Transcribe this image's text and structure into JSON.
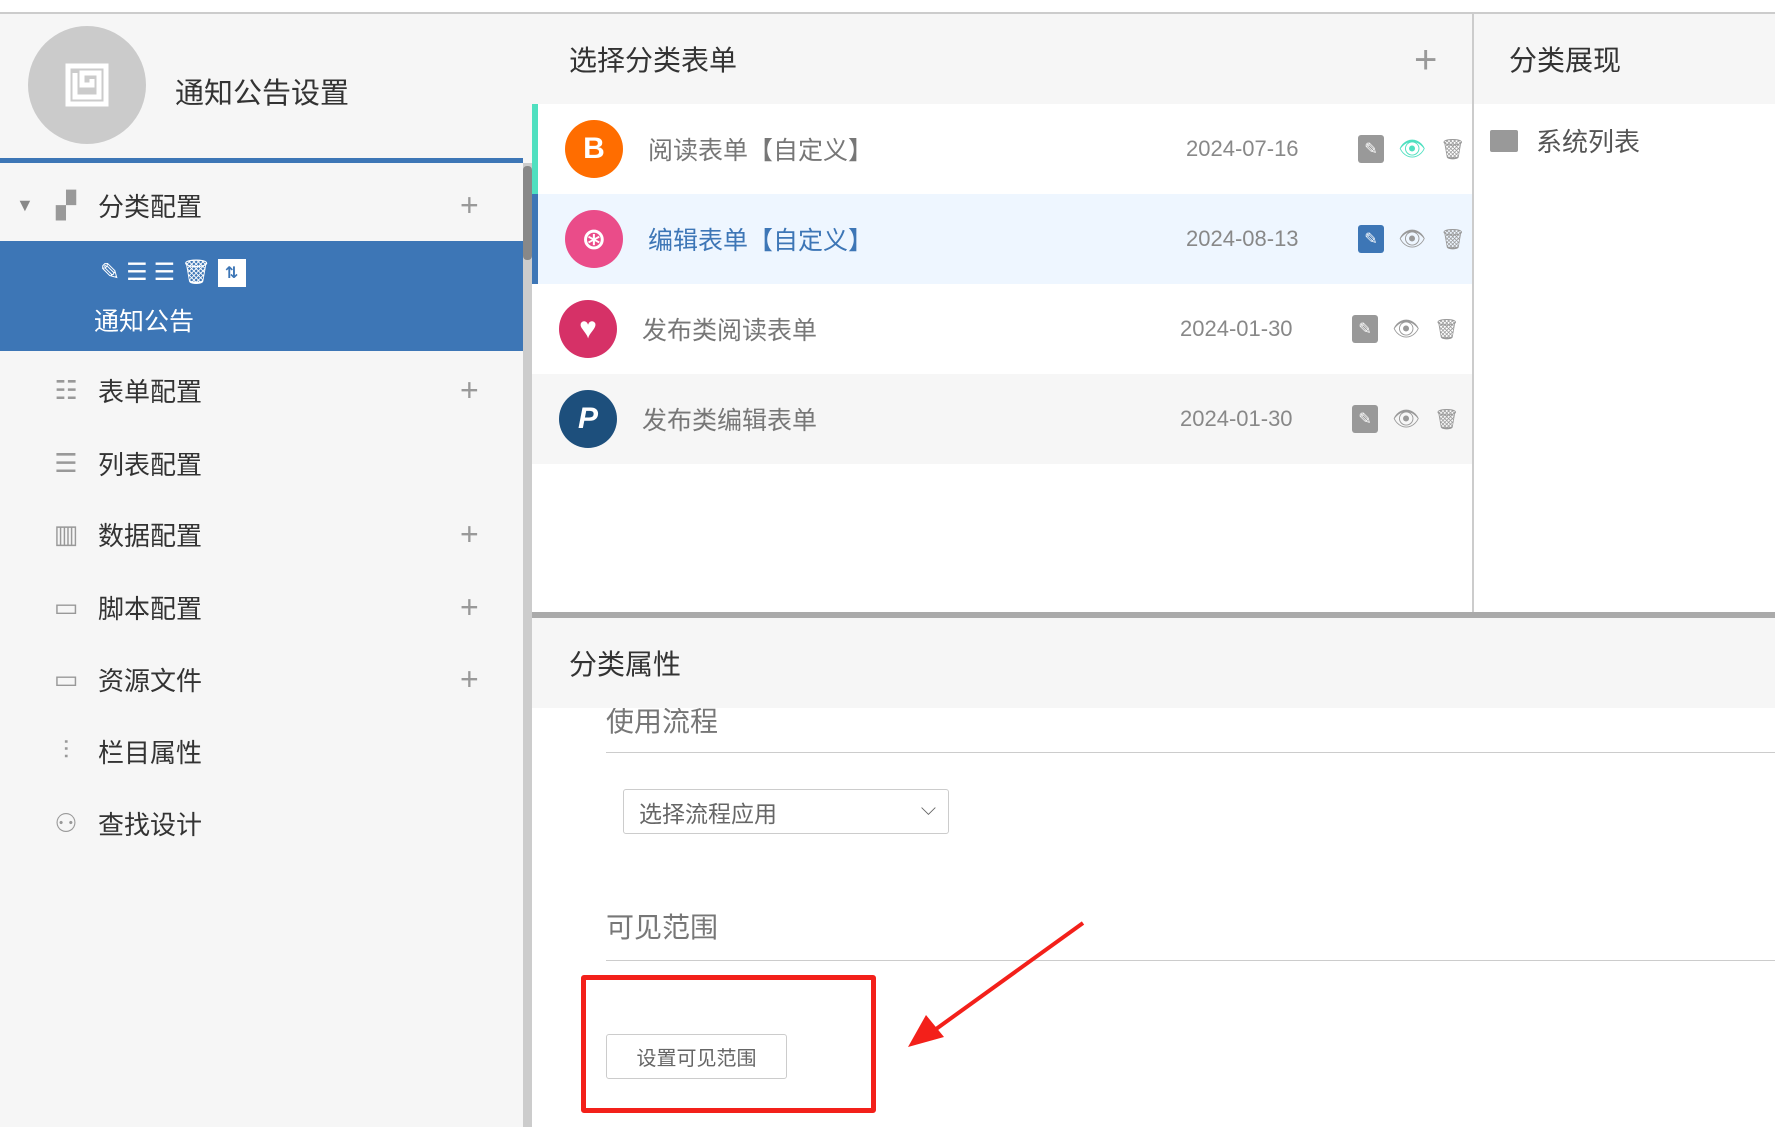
{
  "sidebar": {
    "title": "通知公告设置",
    "tree": {
      "root_label": "分类配置",
      "selected_node": "通知公告",
      "items": [
        {
          "label": "表单配置",
          "icon": "form-sliders-icon",
          "add": true
        },
        {
          "label": "列表配置",
          "icon": "list-icon",
          "add": false
        },
        {
          "label": "数据配置",
          "icon": "bar-chart-icon",
          "add": true
        },
        {
          "label": "脚本配置",
          "icon": "terminal-icon",
          "add": true
        },
        {
          "label": "资源文件",
          "icon": "terminal-icon",
          "add": true
        },
        {
          "label": "栏目属性",
          "icon": "sliders-icon",
          "add": false
        },
        {
          "label": "查找设计",
          "icon": "binoculars-icon",
          "add": false
        }
      ]
    }
  },
  "forms_panel": {
    "title": "选择分类表单",
    "rows": [
      {
        "name": "阅读表单【自定义】",
        "date": "2024-07-16",
        "icon": "blogger-icon",
        "color": "#ff6d00",
        "glyph": "B"
      },
      {
        "name": "编辑表单【自定义】",
        "date": "2024-08-13",
        "icon": "dribbble-icon",
        "color": "#ea4c89",
        "glyph": "⊛"
      },
      {
        "name": "发布类阅读表单",
        "date": "2024-01-30",
        "icon": "heart-icon",
        "color": "#d63167",
        "glyph": "♥"
      },
      {
        "name": "发布类编辑表单",
        "date": "2024-01-30",
        "icon": "paypal-icon",
        "color": "#1d4f7c",
        "glyph": "P"
      }
    ]
  },
  "display_panel": {
    "title": "分类展现",
    "items": [
      "系统列表"
    ]
  },
  "properties": {
    "title": "分类属性",
    "workflow_label": "使用流程",
    "workflow_select": "选择流程应用",
    "visibility_label": "可见范围",
    "visibility_button": "设置可见范围"
  },
  "colors": {
    "accent": "#3d76b6",
    "teal": "#4fe0c0",
    "annotation": "#f3201a"
  }
}
